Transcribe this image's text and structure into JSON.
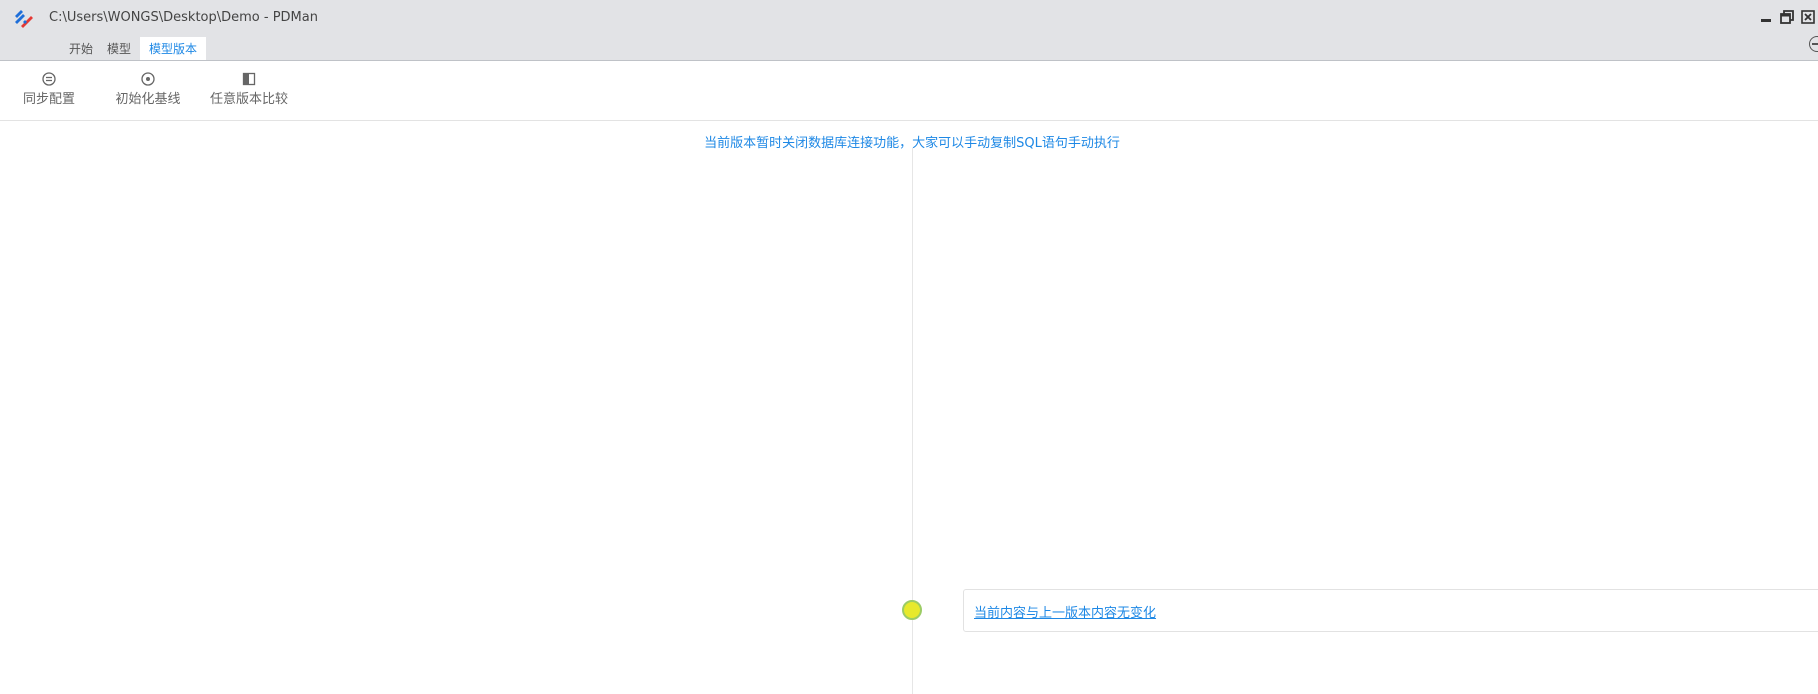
{
  "window": {
    "title": "C:\\Users\\WONGS\\Desktop\\Demo - PDMan"
  },
  "menu": {
    "tabs": [
      {
        "label": "开始"
      },
      {
        "label": "模型"
      },
      {
        "label": "模型版本"
      }
    ],
    "active_tab": "模型版本"
  },
  "toolbar": {
    "items": [
      {
        "label": "同步配置",
        "icon": "sync-settings-icon"
      },
      {
        "label": "初始化基线",
        "icon": "init-baseline-icon"
      },
      {
        "label": "任意版本比较",
        "icon": "compare-icon"
      }
    ]
  },
  "main": {
    "notice": "当前版本暂时关闭数据库连接功能，大家可以手动复制SQL语句手动执行",
    "versions": [
      {
        "link_text": "当前内容与上一版本内容无变化"
      }
    ]
  },
  "colors": {
    "accent": "#1e88e5",
    "titlebar_bg": "#e2e3e6",
    "dot_fill": "#e7e92c",
    "dot_border": "#9ccc65"
  }
}
